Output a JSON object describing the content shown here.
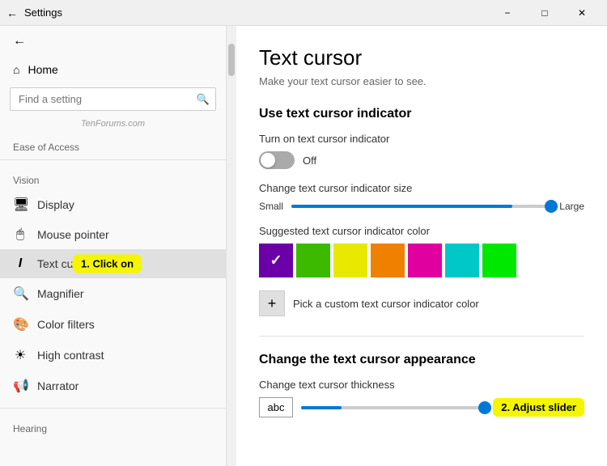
{
  "titlebar": {
    "back_icon": "←",
    "title": "Settings",
    "minimize": "−",
    "maximize": "□",
    "close": "✕"
  },
  "sidebar": {
    "back_icon": "←",
    "home_icon": "⌂",
    "home_label": "Home",
    "search_placeholder": "Find a setting",
    "watermark": "TenForums.com",
    "section_label": "Ease of Access",
    "vision_label": "Vision",
    "nav_items": [
      {
        "icon": "🖥",
        "label": "Display",
        "active": false
      },
      {
        "icon": "🖱",
        "label": "Mouse pointer",
        "active": false
      },
      {
        "icon": "I",
        "label": "Text cursor",
        "active": true,
        "callout": "1. Click on"
      },
      {
        "icon": "🔍",
        "label": "Magnifier",
        "active": false
      },
      {
        "icon": "🎨",
        "label": "Color filters",
        "active": false
      },
      {
        "icon": "☀",
        "label": "High contrast",
        "active": false
      },
      {
        "icon": "📢",
        "label": "Narrator",
        "active": false
      }
    ],
    "hearing_label": "Hearing"
  },
  "content": {
    "page_title": "Text cursor",
    "page_subtitle": "Make your text cursor easier to see.",
    "section1_title": "Use text cursor indicator",
    "toggle_label": "Turn on text cursor indicator",
    "toggle_state": "Off",
    "slider_label": "Change text cursor indicator size",
    "slider_small": "Small",
    "slider_large": "Large",
    "color_label": "Suggested text cursor indicator color",
    "colors": [
      {
        "hex": "#6b00a8",
        "selected": true
      },
      {
        "hex": "#3bba00",
        "selected": false
      },
      {
        "hex": "#e8e800",
        "selected": false
      },
      {
        "hex": "#f08000",
        "selected": false
      },
      {
        "hex": "#e000a0",
        "selected": false
      },
      {
        "hex": "#00c8c8",
        "selected": false
      },
      {
        "hex": "#00e800",
        "selected": false
      }
    ],
    "custom_color_label": "Pick a custom text cursor indicator color",
    "section2_title": "Change the text cursor appearance",
    "thickness_label": "Change text cursor thickness",
    "abc_text": "abc",
    "adjust_callout": "2. Adjust slider"
  }
}
